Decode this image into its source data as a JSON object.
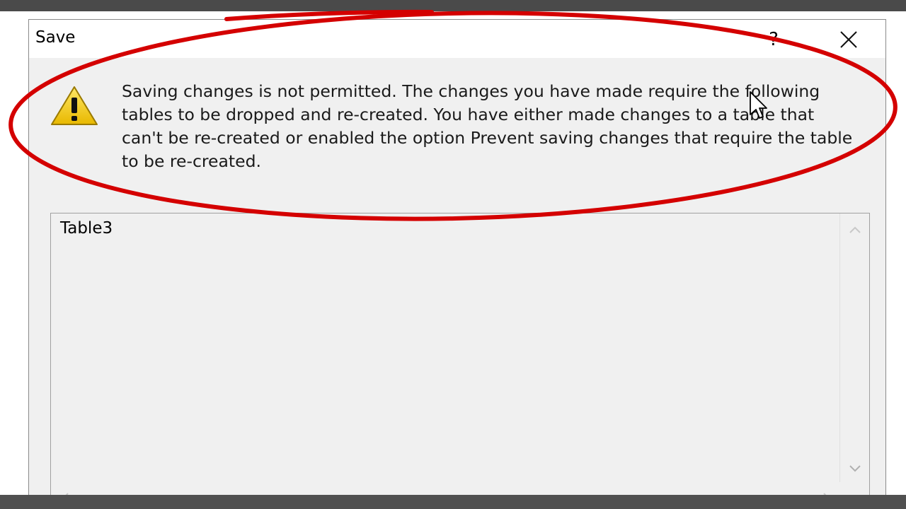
{
  "window": {
    "title": "Save",
    "help_label": "?"
  },
  "message": {
    "text": "Saving changes is not permitted. The changes you have made require the following tables to be dropped and re-created. You have either made changes to a table that can't be re-created or enabled the option Prevent saving changes that require the table to be re-created."
  },
  "table_list": {
    "items": [
      "Table3"
    ]
  },
  "icons": {
    "warning": "warning-icon",
    "close": "close-icon",
    "scroll_up": "chevron-up-icon",
    "scroll_down": "chevron-down-icon",
    "scroll_left": "chevron-left-icon",
    "scroll_right": "chevron-right-icon",
    "cursor": "mouse-pointer-icon"
  },
  "colors": {
    "annotation_ellipse": "#d40000",
    "dialog_background": "#f0f0f0",
    "warning_yellow": "#f5d000"
  }
}
